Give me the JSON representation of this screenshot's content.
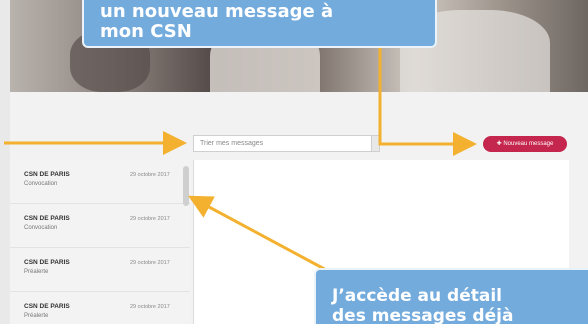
{
  "callouts": {
    "top_line1": "un nouveau message à",
    "top_line2": "mon CSN",
    "bottom_line1": "J’accède au détail",
    "bottom_line2": "des messages déjà"
  },
  "search": {
    "placeholder": "Trier mes messages"
  },
  "new_message_button": "Nouveau message",
  "messages": [
    {
      "from": "CSN DE PARIS",
      "subject": "Convocation",
      "date": "29 octobre 2017"
    },
    {
      "from": "CSN DE PARIS",
      "subject": "Convocation",
      "date": "29 octobre 2017"
    },
    {
      "from": "CSN DE PARIS",
      "subject": "Préalerte",
      "date": "29 octobre 2017"
    },
    {
      "from": "CSN DE PARIS",
      "subject": "Préalerte",
      "date": "29 octobre 2017"
    }
  ],
  "colors": {
    "callout": "#74abdd",
    "arrow": "#f3b12f",
    "button": "#c4264d"
  }
}
